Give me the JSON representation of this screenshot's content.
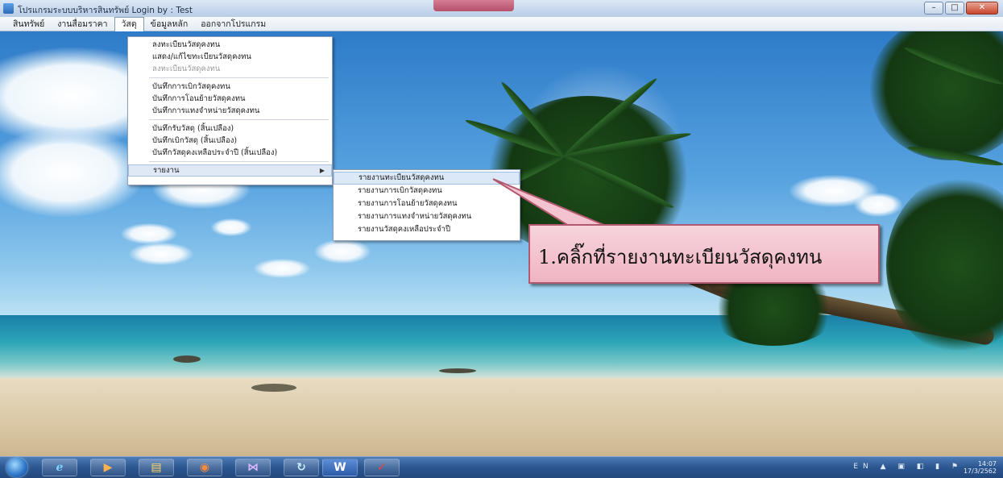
{
  "window": {
    "title": "โปรแกรมระบบบริหารสินทรัพย์ Login by : Test",
    "min_label": "–",
    "max_label": "□",
    "close_label": "✕"
  },
  "menubar": [
    {
      "label": "สินทรัพย์"
    },
    {
      "label": "งานสื่อมราคา"
    },
    {
      "label": "วัสดุ"
    },
    {
      "label": "ข้อมูลหลัก"
    },
    {
      "label": "ออกจากโปรแกรม"
    }
  ],
  "dropdown": {
    "items": [
      {
        "label": "ลงทะเบียนวัสดุคงทน"
      },
      {
        "label": "แสดง/แก้ไขทะเบียนวัสดุคงทน"
      },
      {
        "label": "ลงทะเบียนวัสดุคงทน"
      },
      {
        "label": "บันทึกการเบิกวัสดุคงทน"
      },
      {
        "label": "บันทึกการโอนย้ายวัสดุคงทน"
      },
      {
        "label": "บันทึกการแทงจำหน่ายวัสดุคงทน"
      },
      {
        "label": "บันทึกรับวัสดุ (สิ้นเปลือง)"
      },
      {
        "label": "บันทึกเบิกวัสดุ (สิ้นเปลือง)"
      },
      {
        "label": "บันทึกวัสดุคงเหลือประจำปี (สิ้นเปลือง)"
      },
      {
        "label": "รายงาน"
      }
    ],
    "submenu_arrow": "▶"
  },
  "submenu": {
    "items": [
      {
        "label": "รายงานทะเบียนวัสดุคงทน"
      },
      {
        "label": "รายงานการเบิกวัสดุคงทน"
      },
      {
        "label": "รายงานการโอนย้ายวัสดุคงทน"
      },
      {
        "label": "รายงานการแทงจำหน่ายวัสดุคงทน"
      },
      {
        "label": "รายงานวัสดุคงเหลือประจำปี"
      }
    ]
  },
  "callout": {
    "text": "1.คลิ๊กที่รายงานทะเบียนวัสดุคงทน",
    "fill_color": "#f3c3cf",
    "border_color": "#b3596f"
  },
  "taskbar": {
    "apps": [
      {
        "icon": "internet-explorer-icon",
        "glyph": "e"
      },
      {
        "icon": "media-player-icon",
        "glyph": "▶"
      },
      {
        "icon": "folder-icon",
        "glyph": "▤"
      },
      {
        "icon": "firefox-icon",
        "glyph": "◉"
      },
      {
        "icon": "app-icon",
        "glyph": "⋈"
      },
      {
        "icon": "sync-icon",
        "glyph": "↻"
      },
      {
        "icon": "word-icon",
        "glyph": "W"
      },
      {
        "icon": "program-icon",
        "glyph": "✓"
      }
    ],
    "tray_icons": "EN ▲ ▣ ◧ ▮ ⚑",
    "time": "14:07",
    "date": "17/3/2562"
  }
}
